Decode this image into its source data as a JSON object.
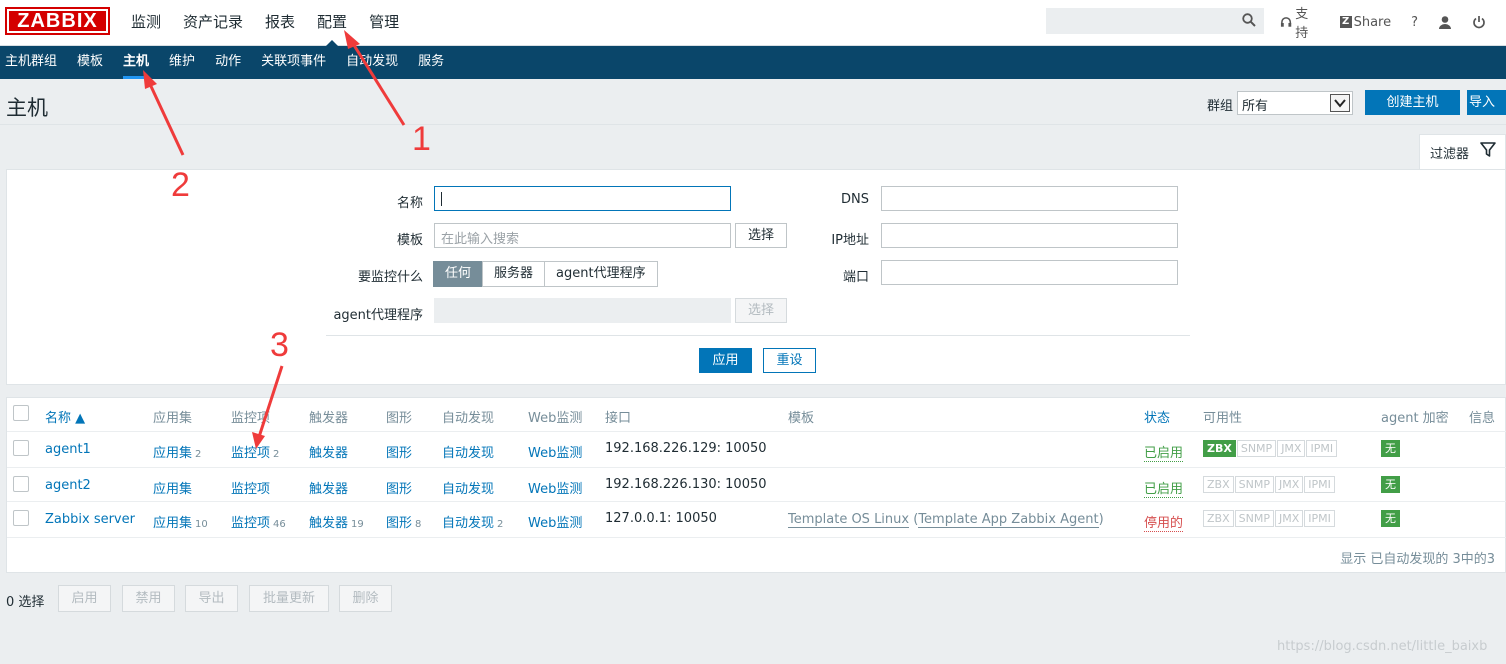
{
  "logo": "ZABBIX",
  "main_menu": [
    "监测",
    "资产记录",
    "报表",
    "配置",
    "管理"
  ],
  "top_links": {
    "support": "支持",
    "share": "Share",
    "help": "?",
    "share_badge": "Z"
  },
  "sub_menu": [
    "主机群组",
    "模板",
    "主机",
    "维护",
    "动作",
    "关联项事件",
    "自动发现",
    "服务"
  ],
  "header": {
    "title": "主机",
    "group_label": "群组",
    "group_value": "所有",
    "create_button": "创建主机",
    "import_button": "导入"
  },
  "filter": {
    "tab_label": "过滤器",
    "name_label": "名称",
    "template_label": "模板",
    "template_placeholder": "在此输入搜索",
    "select_button": "选择",
    "monitored_by_label": "要监控什么",
    "monitored_by_options": [
      "任何",
      "服务器",
      "agent代理程序"
    ],
    "proxy_label": "agent代理程序",
    "dns_label": "DNS",
    "ip_label": "IP地址",
    "port_label": "端口",
    "apply_button": "应用",
    "reset_button": "重设"
  },
  "table": {
    "headers": {
      "name": "名称 ▲",
      "applications": "应用集",
      "items": "监控项",
      "triggers": "触发器",
      "graphs": "图形",
      "discovery": "自动发现",
      "web": "Web监测",
      "interface": "接口",
      "templates": "模板",
      "status": "状态",
      "availability": "可用性",
      "encryption": "agent 加密",
      "info": "信息"
    },
    "availability_labels": [
      "ZBX",
      "SNMP",
      "JMX",
      "IPMI"
    ],
    "rows": [
      {
        "name": "agent1",
        "applications": "应用集",
        "applications_count": "2",
        "items": "监控项",
        "items_count": "2",
        "triggers": "触发器",
        "triggers_count": "",
        "graphs": "图形",
        "graphs_count": "",
        "discovery": "自动发现",
        "discovery_count": "",
        "web": "Web监测",
        "interface": "192.168.226.129: 10050",
        "template_main": "",
        "template_open": "",
        "template_sub": "",
        "template_close": "",
        "status": "已启用",
        "encryption": "无"
      },
      {
        "name": "agent2",
        "applications": "应用集",
        "applications_count": "",
        "items": "监控项",
        "items_count": "",
        "triggers": "触发器",
        "triggers_count": "",
        "graphs": "图形",
        "graphs_count": "",
        "discovery": "自动发现",
        "discovery_count": "",
        "web": "Web监测",
        "interface": "192.168.226.130: 10050",
        "template_main": "",
        "template_open": "",
        "template_sub": "",
        "template_close": "",
        "status": "已启用",
        "encryption": "无"
      },
      {
        "name": "Zabbix server",
        "applications": "应用集",
        "applications_count": "10",
        "items": "监控项",
        "items_count": "46",
        "triggers": "触发器",
        "triggers_count": "19",
        "graphs": "图形",
        "graphs_count": "8",
        "discovery": "自动发现",
        "discovery_count": "2",
        "web": "Web监测",
        "interface": "127.0.0.1: 10050",
        "template_main": "Template OS Linux",
        "template_open": " (",
        "template_sub": "Template App Zabbix Agent",
        "template_close": ")",
        "status": "停用的",
        "encryption": "无"
      }
    ],
    "footer": "显示 已自动发现的 3中的3"
  },
  "actions": {
    "selected": "0 选择",
    "buttons": [
      "启用",
      "禁用",
      "导出",
      "批量更新",
      "删除"
    ]
  },
  "watermark": "https://blog.csdn.net/little_baixb",
  "annotations": [
    "1",
    "2",
    "3"
  ],
  "colors": {
    "accent": "#0275b8",
    "nav": "#0a466a",
    "logo": "#d40000",
    "ok": "#429e47",
    "bad": "#d64e4e",
    "annotation": "#ef3b3b"
  }
}
